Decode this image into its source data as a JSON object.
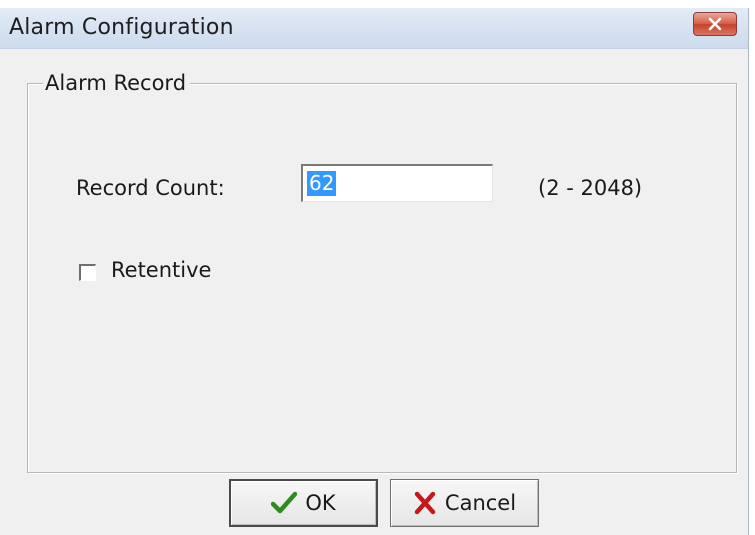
{
  "window": {
    "title": "Alarm Configuration",
    "close_icon": "close-icon"
  },
  "group": {
    "legend": "Alarm Record"
  },
  "record_count": {
    "label": "Record Count:",
    "value": "62",
    "range_hint": "(2 - 2048)"
  },
  "retentive": {
    "label": "Retentive",
    "checked": false
  },
  "buttons": {
    "ok": {
      "label": "OK",
      "icon": "checkmark-icon",
      "icon_color": "#2e8b1e"
    },
    "cancel": {
      "label": "Cancel",
      "icon": "x-icon",
      "icon_color": "#c8171a"
    }
  },
  "colors": {
    "selection": "#3399ff",
    "titlebar": "#d6e2f1",
    "close_button": "#c7422c"
  }
}
